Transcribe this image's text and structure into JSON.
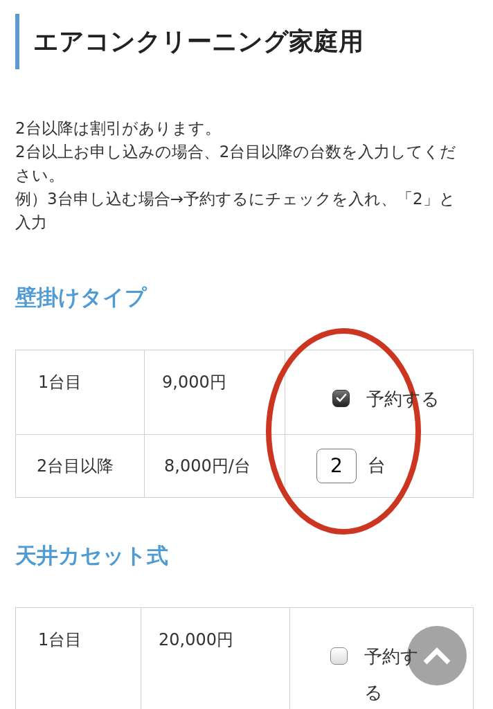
{
  "title": "エアコンクリーニング家庭用",
  "intro": [
    "2台以降は割引があります。",
    "2台以上お申し込みの場合、2台目以降の台数を入力してください。",
    "例）3台申し込む場合→予約するにチェックを入れ、「2」と入力"
  ],
  "sections": [
    {
      "heading": "壁掛けタイプ",
      "rows": [
        {
          "label": "1台目",
          "price": "9,000円",
          "kind": "checkbox",
          "checked": true,
          "option_label": "予約する"
        },
        {
          "label": "2台目以降",
          "price": "8,000円/台",
          "kind": "quantity",
          "value": "2",
          "unit": "台"
        }
      ]
    },
    {
      "heading": "天井カセット式",
      "rows": [
        {
          "label": "1台目",
          "price": "20,000円",
          "kind": "checkbox",
          "checked": false,
          "option_label": "予約する"
        }
      ]
    }
  ]
}
